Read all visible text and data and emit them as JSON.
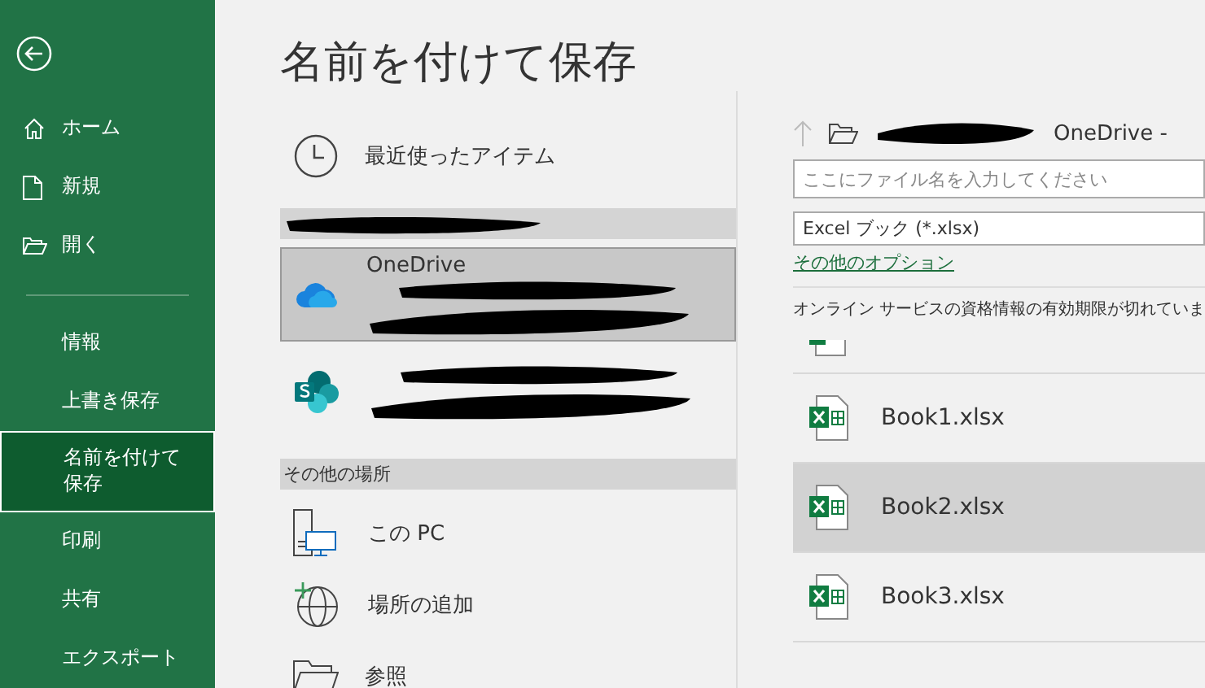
{
  "sidebar": {
    "items": [
      {
        "label": "ホーム",
        "kind": "home",
        "selected": false
      },
      {
        "label": "新規",
        "kind": "new",
        "selected": false
      },
      {
        "label": "開く",
        "kind": "open",
        "selected": false
      },
      {
        "kind": "divider"
      },
      {
        "label": "情報",
        "kind": "plain",
        "selected": false
      },
      {
        "label": "上書き保存",
        "kind": "plain",
        "selected": false
      },
      {
        "label": "名前を付けて保存",
        "kind": "plain",
        "selected": true
      },
      {
        "label": "印刷",
        "kind": "plain",
        "selected": false
      },
      {
        "label": "共有",
        "kind": "plain",
        "selected": false
      },
      {
        "label": "エクスポート",
        "kind": "plain",
        "selected": false
      }
    ]
  },
  "page": {
    "title": "名前を付けて保存"
  },
  "locations": [
    {
      "kind": "recent",
      "label": "最近使ったアイテム",
      "selected": false
    },
    {
      "kind": "header",
      "redacted": true
    },
    {
      "kind": "onedrive",
      "label": "OneDrive",
      "redacted": true,
      "selected": true
    },
    {
      "kind": "sharepoint",
      "redacted": true,
      "selected": false
    },
    {
      "kind": "header",
      "label": "その他の場所"
    },
    {
      "kind": "pc",
      "label": "この PC",
      "selected": false
    },
    {
      "kind": "add",
      "label": "場所の追加",
      "selected": false
    },
    {
      "kind": "browse",
      "label": "参照",
      "selected": false
    }
  ],
  "save": {
    "path": "OneDrive -",
    "path_redacted": true,
    "filename": {
      "placeholder": "ここにファイル名を入力してください"
    },
    "file_type": "Excel ブック (*.xlsx)",
    "more_options": "その他のオプション",
    "message": "オンライン サービスの資格情報の有効期限が切れていま"
  },
  "files": [
    {
      "kind": "cut",
      "selected": false
    },
    {
      "kind": "file",
      "name": "Book1.xlsx",
      "selected": false
    },
    {
      "kind": "file",
      "name": "Book2.xlsx",
      "selected": true
    },
    {
      "kind": "file",
      "name": "Book3.xlsx",
      "selected": false
    }
  ]
}
